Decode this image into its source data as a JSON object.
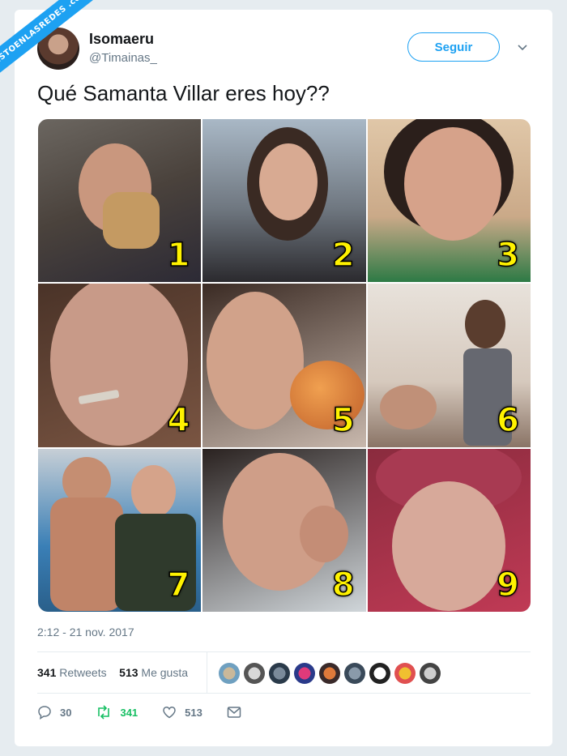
{
  "watermark": "VISTOENLASREDES .com",
  "author": {
    "name": "Isomaeru",
    "handle": "@Timainas_"
  },
  "follow_label": "Seguir",
  "tweet_text": "Qué Samanta Villar eres hoy??",
  "photos": [
    {
      "number": "1"
    },
    {
      "number": "2"
    },
    {
      "number": "3"
    },
    {
      "number": "4"
    },
    {
      "number": "5"
    },
    {
      "number": "6"
    },
    {
      "number": "7"
    },
    {
      "number": "8"
    },
    {
      "number": "9"
    }
  ],
  "timestamp": "2:12 - 21 nov. 2017",
  "stats": {
    "retweets_count": "341",
    "retweets_label": "Retweets",
    "likes_count": "513",
    "likes_label": "Me gusta"
  },
  "actions": {
    "replies": "30",
    "retweets": "341",
    "likes": "513"
  },
  "colors": {
    "accent": "#1da1f2",
    "retweet_active": "#17bf63",
    "number_label": "#fff200"
  }
}
